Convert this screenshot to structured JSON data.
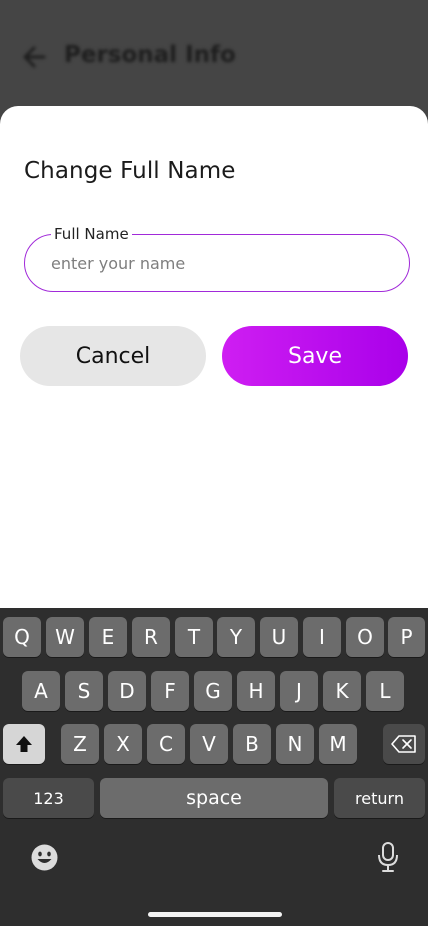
{
  "header": {
    "title": "Personal Info",
    "back_icon": "arrow-left-icon"
  },
  "sheet": {
    "title": "Change Full Name",
    "field_label": "Full Name",
    "field_placeholder": "enter your name",
    "field_value": "",
    "cancel_label": "Cancel",
    "save_label": "Save"
  },
  "colors": {
    "accent": "#b70ff0",
    "field_border": "#a12ad9",
    "cancel_bg": "#e6e6e6",
    "keyboard_bg": "#2e2e2e"
  },
  "keyboard": {
    "row1": [
      "Q",
      "W",
      "E",
      "R",
      "T",
      "Y",
      "U",
      "I",
      "O",
      "P"
    ],
    "row2": [
      "A",
      "S",
      "D",
      "F",
      "G",
      "H",
      "J",
      "K",
      "L"
    ],
    "row3": [
      "Z",
      "X",
      "C",
      "V",
      "B",
      "N",
      "M"
    ],
    "numbers_label": "123",
    "space_label": "space",
    "return_label": "return",
    "shift_icon": "shift-icon",
    "backspace_icon": "backspace-icon",
    "emoji_icon": "emoji-icon",
    "mic_icon": "microphone-icon"
  }
}
